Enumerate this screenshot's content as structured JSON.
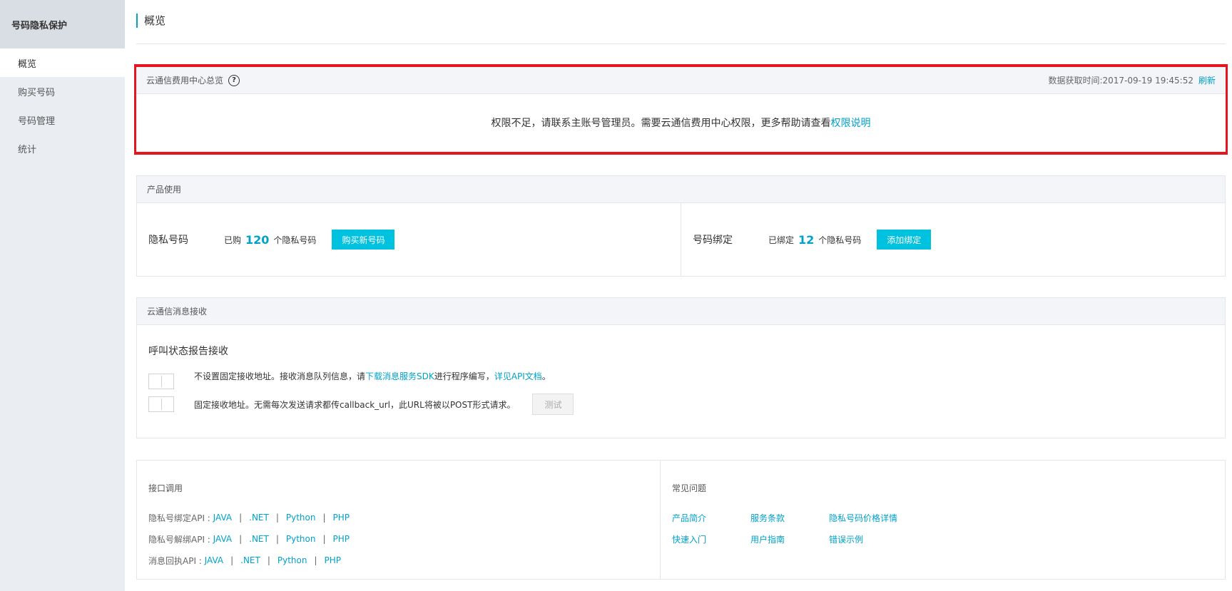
{
  "sidebar": {
    "title": "号码隐私保护",
    "items": [
      {
        "label": "概览"
      },
      {
        "label": "购买号码"
      },
      {
        "label": "号码管理"
      },
      {
        "label": "统计"
      }
    ]
  },
  "page": {
    "title": "概览"
  },
  "overview_panel": {
    "title": "云通信费用中心总览",
    "fetch_time": "数据获取时间:2017-09-19 19:45:52",
    "refresh_label": "刷新",
    "message": "权限不足，请联系主账号管理员。需要云通信费用中心权限，更多帮助请查看",
    "message_link": "权限说明"
  },
  "product_panel": {
    "title": "产品使用",
    "privacy_numbers": {
      "label": "隐私号码",
      "prefix": "已购",
      "count": "120",
      "suffix": "个隐私号码",
      "button": "购买新号码"
    },
    "number_binding": {
      "label": "号码绑定",
      "prefix": "已绑定",
      "count": "12",
      "suffix": "个隐私号码",
      "button": "添加绑定"
    }
  },
  "message_panel": {
    "title": "云通信消息接收",
    "subtitle": "呼叫状态报告接收",
    "option1": {
      "text_a": "不设置固定接收地址。接收消息队列信息，请",
      "link_a": "下载消息服务SDK",
      "text_b": "进行程序编写，",
      "link_b": "详见API文档",
      "text_c": "。"
    },
    "option2": {
      "text": "固定接收地址。无需每次发送请求都传callback_url，此URL将被以POST形式请求。",
      "button": "测试"
    }
  },
  "api_panel": {
    "title": "接口调用",
    "separator": "|",
    "rows": [
      {
        "label": "隐私号绑定API :",
        "links": [
          "JAVA",
          ".NET",
          "Python",
          "PHP"
        ]
      },
      {
        "label": "隐私号解绑API :",
        "links": [
          "JAVA",
          ".NET",
          "Python",
          "PHP"
        ]
      },
      {
        "label": "消息回执API :",
        "links": [
          "JAVA",
          ".NET",
          "Python",
          "PHP"
        ]
      }
    ]
  },
  "faq_panel": {
    "title": "常见问题",
    "links": [
      "产品简介",
      "服务条款",
      "隐私号码价格详情",
      "快速入门",
      "用户指南",
      "错误示例"
    ]
  },
  "colors": {
    "accent": "#00a2ca",
    "button": "#00c1de",
    "highlight": "#e6141e"
  },
  "icons": {
    "help": "question-circle-icon"
  }
}
